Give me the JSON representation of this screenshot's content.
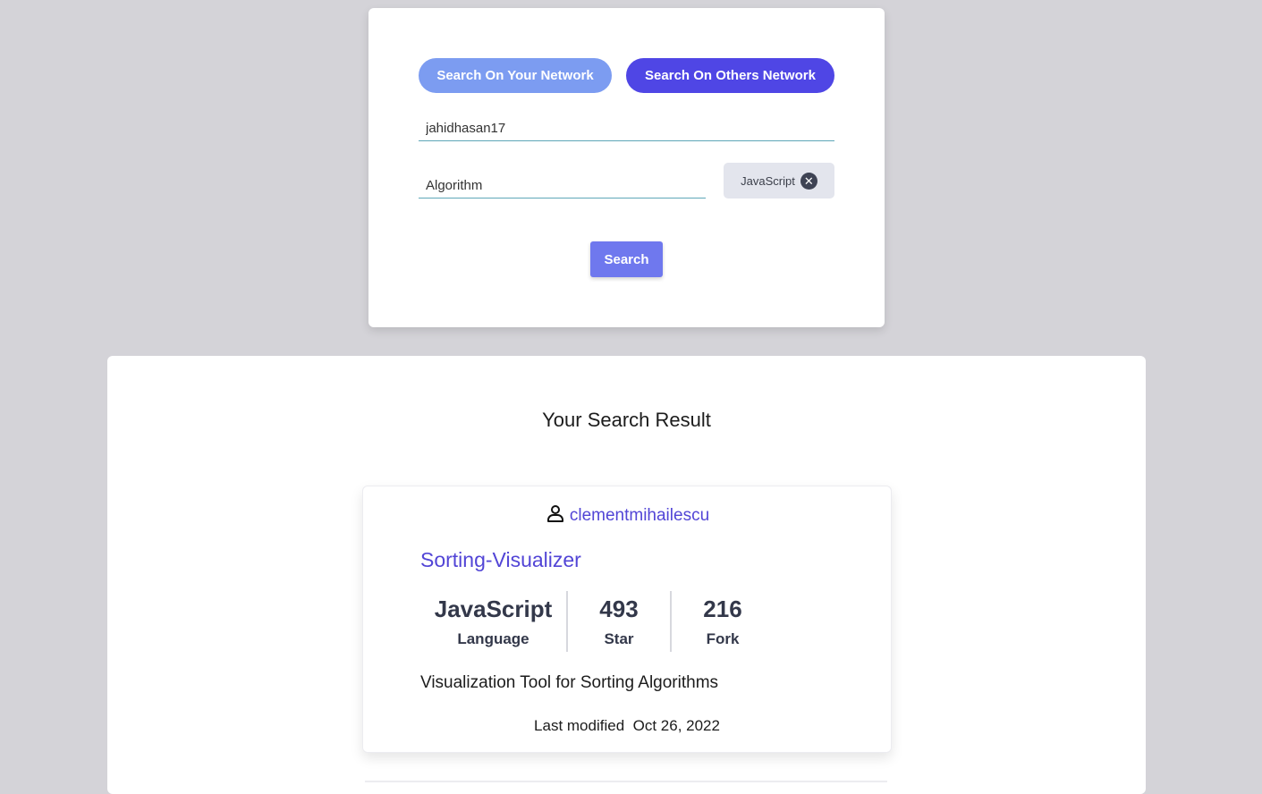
{
  "search": {
    "network_tab_yours": "Search On Your Network",
    "network_tab_others": "Search On Others Network",
    "username_value": "jahidhasan17",
    "topic_value": "Algorithm",
    "language_chip": "JavaScript",
    "language_chip_remove_icon": "close-circle-icon",
    "submit_label": "Search"
  },
  "results": {
    "title": "Your Search Result",
    "items": [
      {
        "owner_icon": "user-icon",
        "owner": "clementmihailescu",
        "repo_name": "Sorting-Visualizer",
        "language_value": "JavaScript",
        "language_label": "Language",
        "stars_value": "493",
        "stars_label": "Star",
        "forks_value": "216",
        "forks_label": "Fork",
        "description": "Visualization Tool for Sorting Algorithms",
        "modified_label": "Last modified",
        "modified_date": "Oct 26, 2022"
      }
    ]
  },
  "colors": {
    "page_background": "#d4d3d8",
    "tab_yours": "#7c9cf1",
    "tab_others": "#4f46e5",
    "search_button": "#6f78ee",
    "link": "#5245d6",
    "input_underline": "#5ea7b8"
  }
}
